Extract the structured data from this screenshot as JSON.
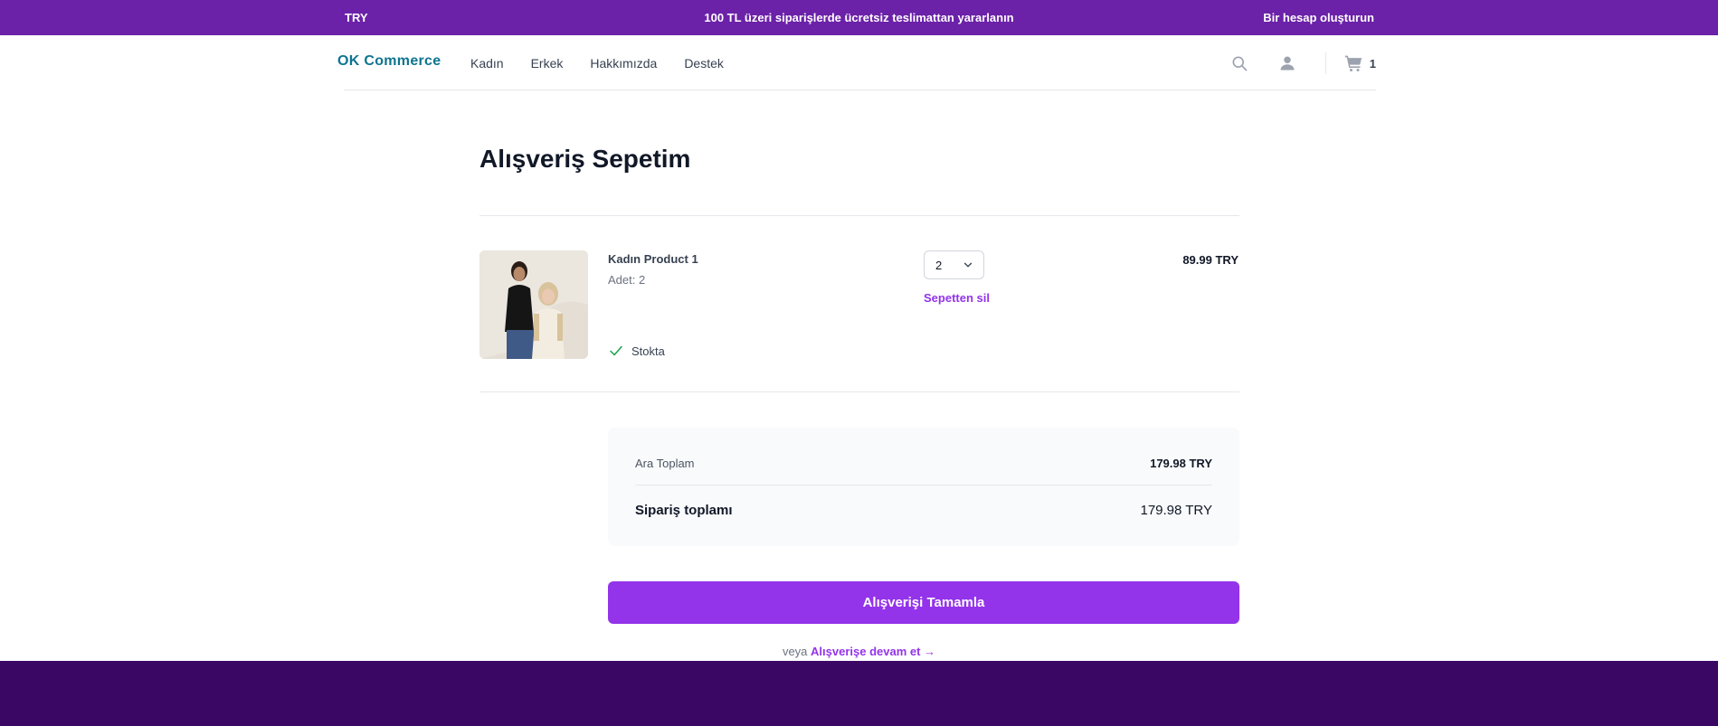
{
  "topbar": {
    "currency": "TRY",
    "promo": "100 TL üzeri siparişlerde ücretsiz teslimattan yararlanın",
    "account_link": "Bir hesap oluşturun"
  },
  "header": {
    "logo": "OK Commerce",
    "nav": [
      "Kadın",
      "Erkek",
      "Hakkımızda",
      "Destek"
    ],
    "cart_count": "1",
    "icons": [
      "search-icon",
      "user-icon",
      "cart-icon"
    ]
  },
  "cart": {
    "title": "Alışveriş Sepetim",
    "items": [
      {
        "name": "Kadın Product 1",
        "quantity_text": "Adet: 2",
        "quantity_selected": "2",
        "remove_label": "Sepetten sil",
        "price": "89.99 TRY",
        "stock_label": "Stokta"
      }
    ]
  },
  "summary": {
    "subtotal_label": "Ara Toplam",
    "subtotal_value": "179.98 TRY",
    "total_label": "Sipariş toplamı",
    "total_value": "179.98 TRY"
  },
  "actions": {
    "checkout_label": "Alışverişi Tamamla",
    "or_text": "veya",
    "continue_label": "Alışverişe devam et →"
  },
  "colors": {
    "topbar": "#6b21a8",
    "accent": "#9333ea",
    "logo": "#0e7490",
    "footer": "#3b0764",
    "stock_check": "#16a34a"
  }
}
